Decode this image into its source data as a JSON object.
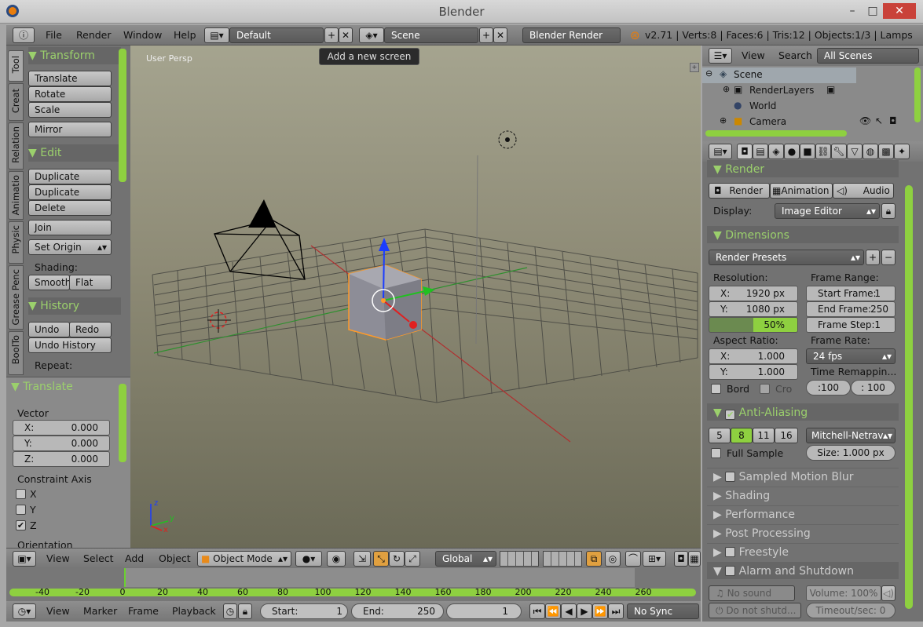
{
  "window": {
    "title": "Blender",
    "minimize": "–",
    "maximize": "□",
    "close": "✕"
  },
  "info_header": {
    "menus": [
      "File",
      "Render",
      "Window",
      "Help"
    ],
    "screen_layout": "Default",
    "scene": "Scene",
    "engine": "Blender Render",
    "stats": "v2.71 | Verts:8 | Faces:6 | Tris:12 | Objects:1/3 | Lamps"
  },
  "tooltip": "Add a new screen",
  "tool_shelf": {
    "tabs": [
      "Tool",
      "Creat",
      "Relation",
      "Animatio",
      "Physic",
      "Grease Penc",
      "BoolTo"
    ],
    "transform": {
      "title": "Transform",
      "buttons": [
        "Translate",
        "Rotate",
        "Scale"
      ],
      "mirror": "Mirror"
    },
    "edit": {
      "title": "Edit",
      "buttons": [
        "Duplicate",
        "Duplicate Linked",
        "Delete"
      ],
      "join": "Join",
      "set_origin": "Set Origin"
    },
    "shading": {
      "label": "Shading:",
      "smooth": "Smooth",
      "flat": "Flat"
    },
    "history": {
      "title": "History",
      "undo": "Undo",
      "redo": "Redo",
      "undo_history": "Undo History",
      "repeat": "Repeat:"
    }
  },
  "operator_panel": {
    "title": "Translate",
    "vector_label": "Vector",
    "vector": [
      {
        "k": "X:",
        "v": "0.000"
      },
      {
        "k": "Y:",
        "v": "0.000"
      },
      {
        "k": "Z:",
        "v": "0.000"
      }
    ],
    "constraint_label": "Constraint Axis",
    "axes": [
      {
        "k": "X",
        "checked": false
      },
      {
        "k": "Y",
        "checked": false
      },
      {
        "k": "Z",
        "checked": true
      }
    ],
    "orientation_label": "Orientation"
  },
  "viewport": {
    "label": "User Persp",
    "axis_x": "x",
    "axis_y": "y",
    "axis_z": "z"
  },
  "viewport_header": {
    "menus": [
      "View",
      "Select",
      "Add",
      "Object"
    ],
    "mode": "Object Mode",
    "orientation": "Global"
  },
  "timeline": {
    "ticks": [
      "-40",
      "-20",
      "0",
      "20",
      "40",
      "60",
      "80",
      "100",
      "120",
      "140",
      "160",
      "180",
      "200",
      "220",
      "240",
      "260"
    ],
    "menus": [
      "View",
      "Marker",
      "Frame",
      "Playback"
    ],
    "start_label": "Start:",
    "start": "1",
    "end_label": "End:",
    "end": "250",
    "current": "1",
    "sync": "No Sync"
  },
  "outliner": {
    "menus": [
      "View",
      "Search"
    ],
    "filter": "All Scenes",
    "items": [
      "Scene",
      "RenderLayers",
      "World",
      "Camera"
    ]
  },
  "properties": {
    "render": {
      "title": "Render",
      "buttons": [
        "Render",
        "Animation",
        "Audio"
      ],
      "display_label": "Display:",
      "display": "Image Editor"
    },
    "dimensions": {
      "title": "Dimensions",
      "presets": "Render Presets",
      "resolution_label": "Resolution:",
      "res_x": {
        "k": "X:",
        "v": "1920 px"
      },
      "res_y": {
        "k": "Y:",
        "v": "1080 px"
      },
      "res_pct": "50%",
      "res_fill": 0.5,
      "frame_range_label": "Frame Range:",
      "start_frame": "Start Frame:",
      "start_frame_v": "1",
      "end_frame": "End Frame:",
      "end_frame_v": "250",
      "frame_step": "Frame Step:",
      "frame_step_v": "1",
      "aspect_label": "Aspect Ratio:",
      "asp_x": {
        "k": "X:",
        "v": "1.000"
      },
      "asp_y": {
        "k": "Y:",
        "v": "1.000"
      },
      "frame_rate_label": "Frame Rate:",
      "frame_rate": "24 fps",
      "bord": "Bord",
      "cro": "Cro",
      "remap_label": "Time Remappin...",
      "remap_old": ":100",
      "remap_new": ": 100"
    },
    "aa": {
      "title": "Anti-Aliasing",
      "samples": [
        "5",
        "8",
        "11",
        "16"
      ],
      "filter": "Mitchell-Netrav...",
      "full_sample": "Full Sample",
      "size": "Size:  1.000 px"
    },
    "closed_panels": [
      "Sampled Motion Blur",
      "Shading",
      "Performance",
      "Post Processing",
      "Freestyle",
      "Alarm and Shutdown"
    ],
    "sound": "No sound",
    "volume": "Volume: 100%",
    "shutdown": "Do not shutd...",
    "timeout": "Timeout/sec:  0"
  },
  "colors": {
    "accent": "#9bd06c",
    "selected": "#8ed040",
    "viewport_top": "#a5a48f"
  }
}
